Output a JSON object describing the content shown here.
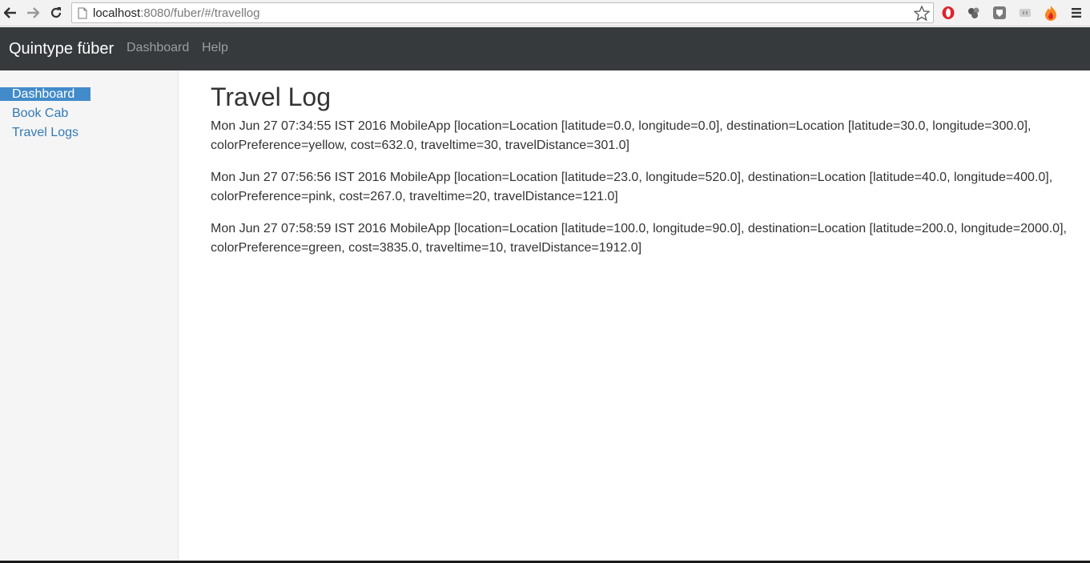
{
  "browser": {
    "url_host": "localhost",
    "url_rest": ":8080/fuber/#/travellog",
    "icons": [
      "back-arrow-icon",
      "forward-arrow-icon",
      "reload-icon",
      "page-icon",
      "star-icon",
      "opera-icon",
      "extension-icon",
      "shield-icon",
      "extension-icon",
      "fire-icon",
      "menu-icon"
    ]
  },
  "navbar": {
    "brand": "Quintype füber",
    "links": [
      {
        "label": "Dashboard"
      },
      {
        "label": "Help"
      }
    ],
    "background": "#363a3d"
  },
  "sidebar": {
    "items": [
      {
        "label": "Dashboard",
        "active": true
      },
      {
        "label": "Book Cab",
        "active": false
      },
      {
        "label": "Travel Logs",
        "active": false
      }
    ],
    "active_color": "#428bca",
    "link_color": "#337ab7"
  },
  "main": {
    "title": "Travel Log",
    "entries": [
      {
        "text": "Mon Jun 27 07:34:55 IST 2016 MobileApp [location=Location [latitude=0.0, longitude=0.0], destination=Location [latitude=30.0, longitude=300.0], colorPreference=yellow, cost=632.0, traveltime=30, travelDistance=301.0]"
      },
      {
        "text": "Mon Jun 27 07:56:56 IST 2016 MobileApp [location=Location [latitude=23.0, longitude=520.0], destination=Location [latitude=40.0, longitude=400.0], colorPreference=pink, cost=267.0, traveltime=20, travelDistance=121.0]"
      },
      {
        "text": "Mon Jun 27 07:58:59 IST 2016 MobileApp [location=Location [latitude=100.0, longitude=90.0], destination=Location [latitude=200.0, longitude=2000.0], colorPreference=green, cost=3835.0, traveltime=10, travelDistance=1912.0]"
      }
    ]
  }
}
